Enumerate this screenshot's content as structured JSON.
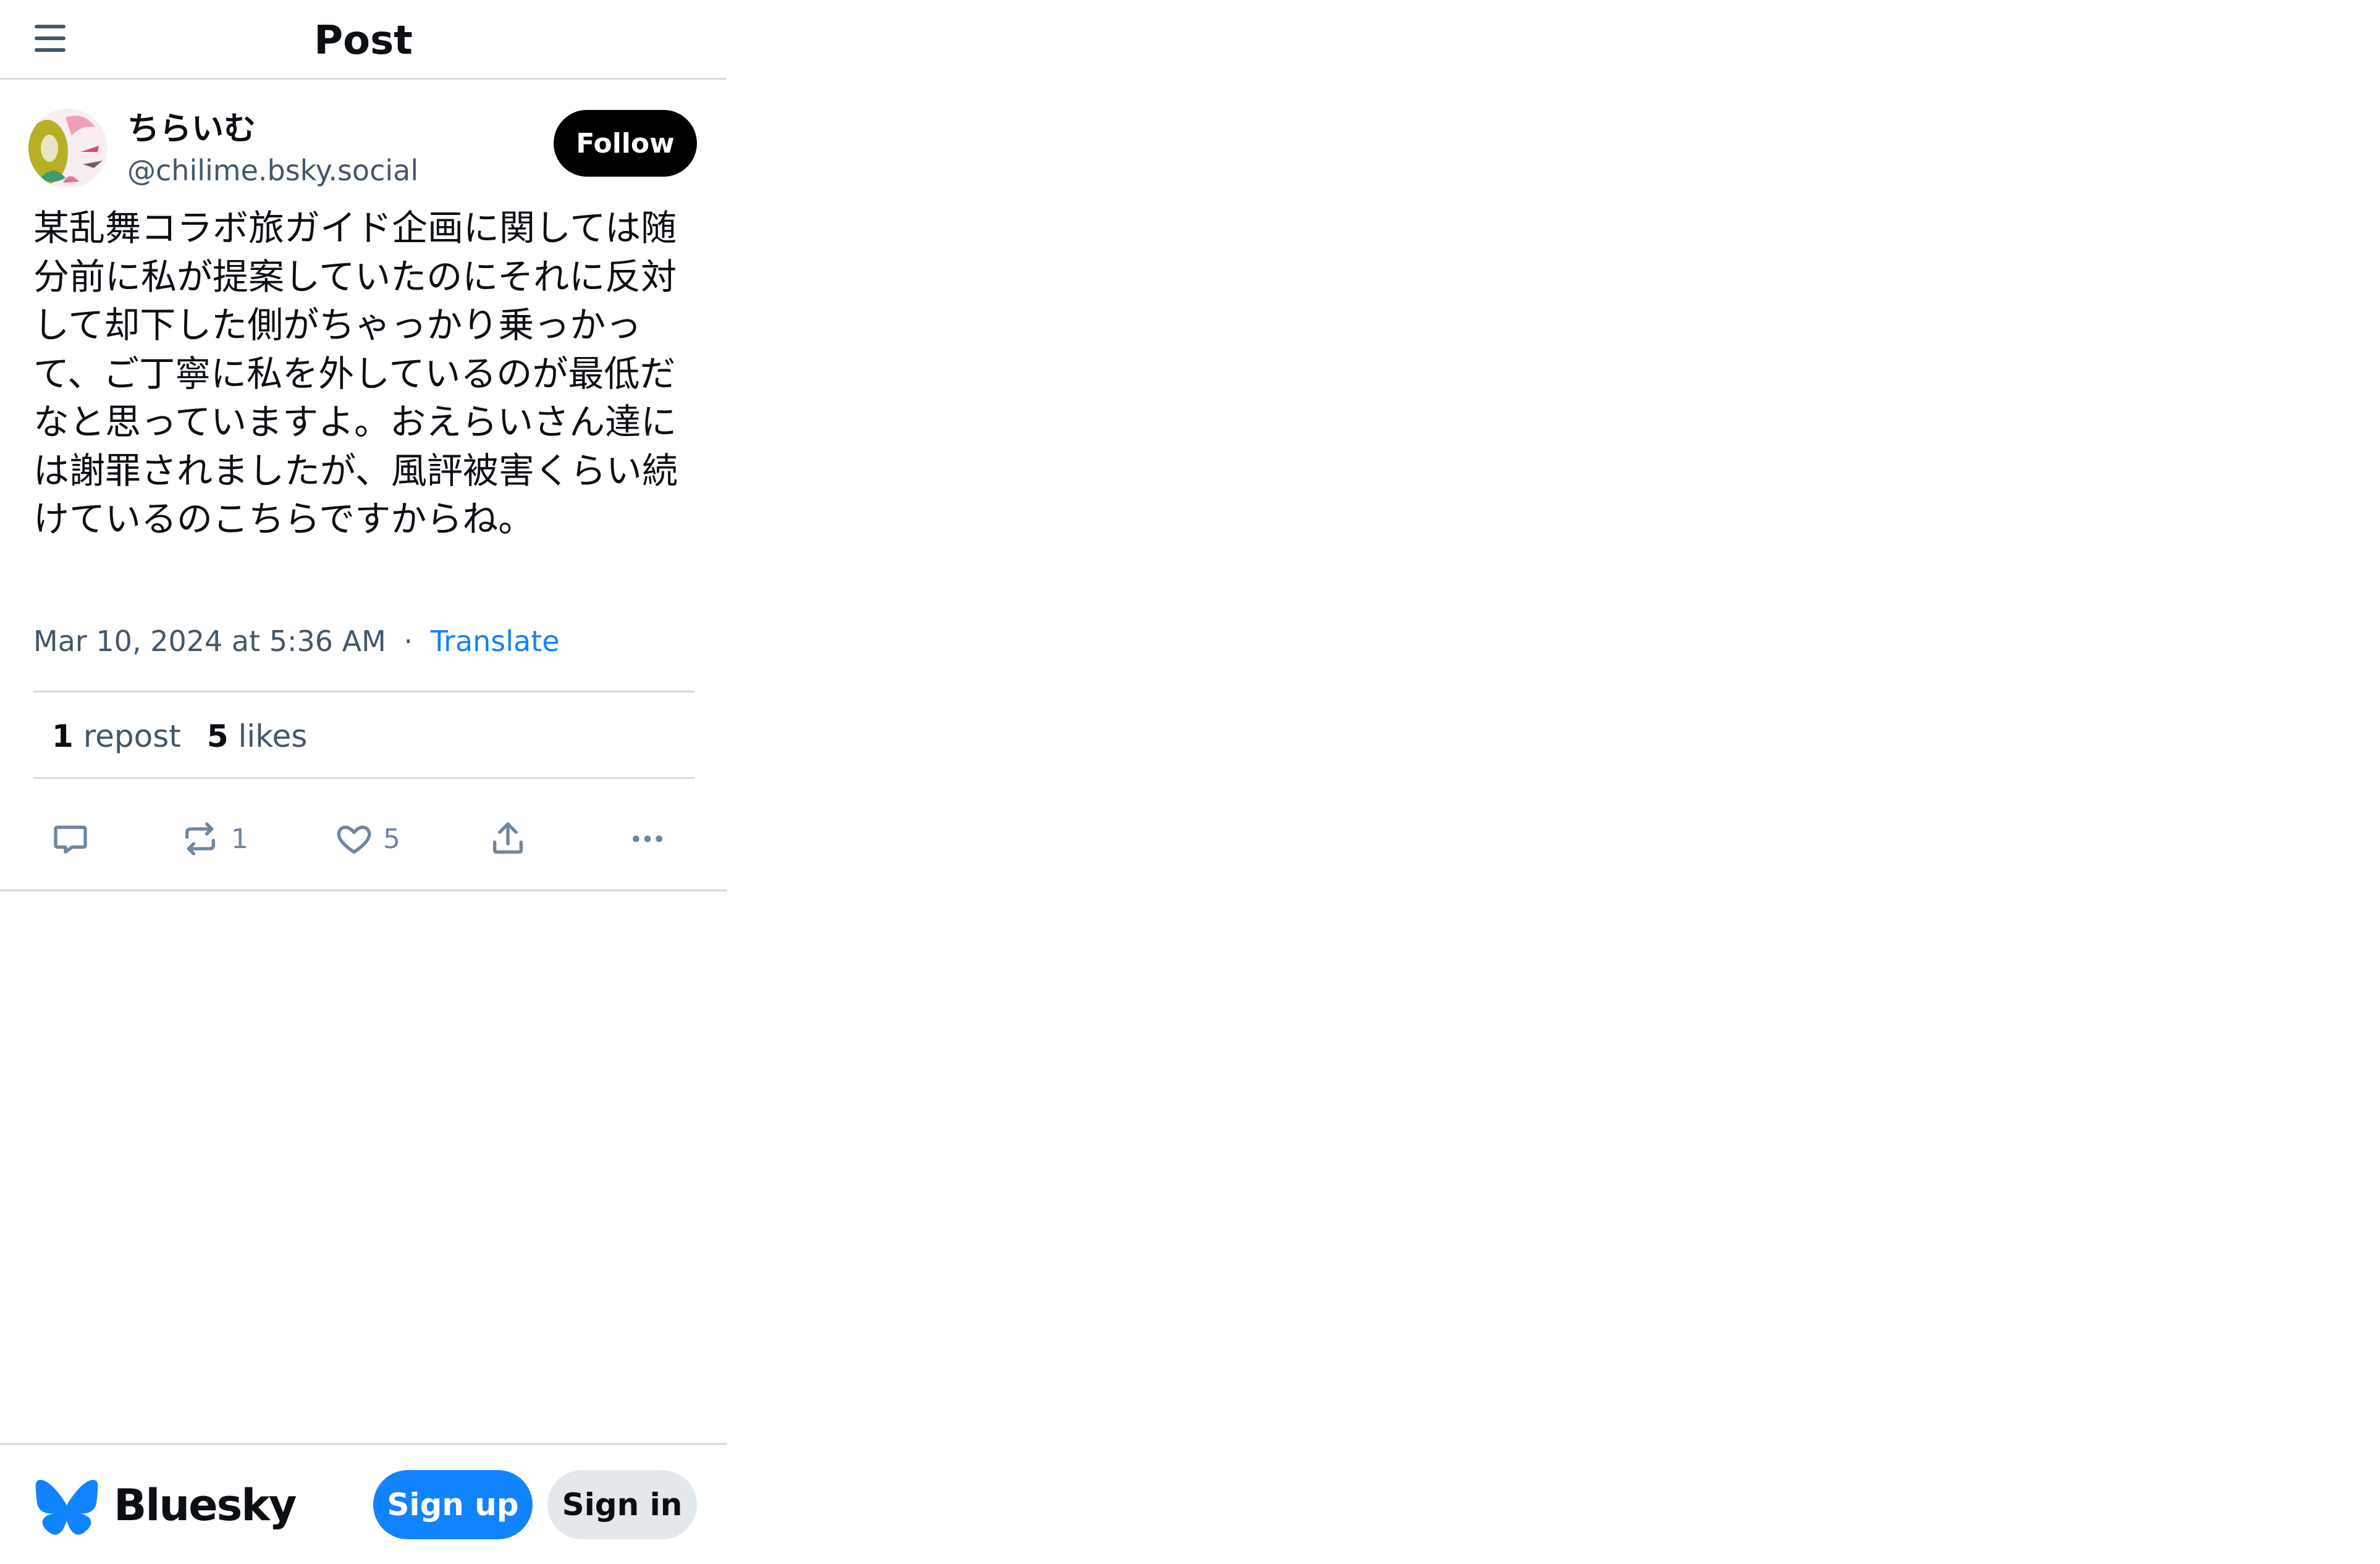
{
  "header": {
    "title": "Post",
    "menu_icon": "hamburger-icon"
  },
  "author": {
    "display_name": "ちらいむ",
    "handle": "@chilime.bsky.social",
    "follow_label": "Follow"
  },
  "post": {
    "text": "某乱舞コラボ旅ガイド企画に関しては随分前に私が提案していたのにそれに反対して却下した側がちゃっかり乗っかって、ご丁寧に私を外しているのが最低だなと思っていますよ。おえらいさん達には謝罪されましたが、風評被害くらい続けているのこちらですからね。",
    "timestamp": "Mar 10, 2024 at 5:36 AM",
    "separator": "·",
    "translate_label": "Translate"
  },
  "stats": {
    "reposts": "1",
    "repost_label": "repost",
    "likes": "5",
    "likes_label": "likes"
  },
  "actions": {
    "reply_icon": "reply-icon",
    "repost_icon": "repost-icon",
    "repost_count": "1",
    "like_icon": "heart-icon",
    "like_count": "5",
    "share_icon": "share-icon",
    "more_icon": "more-icon"
  },
  "footer": {
    "brand": "Bluesky",
    "signup_label": "Sign up",
    "signin_label": "Sign in"
  },
  "colors": {
    "accent": "#1083fe",
    "muted_text": "#42576c",
    "icon": "#6f869f",
    "divider": "#d4dbe2",
    "follow_bg": "#000000",
    "signin_bg": "#e3e8ed"
  }
}
